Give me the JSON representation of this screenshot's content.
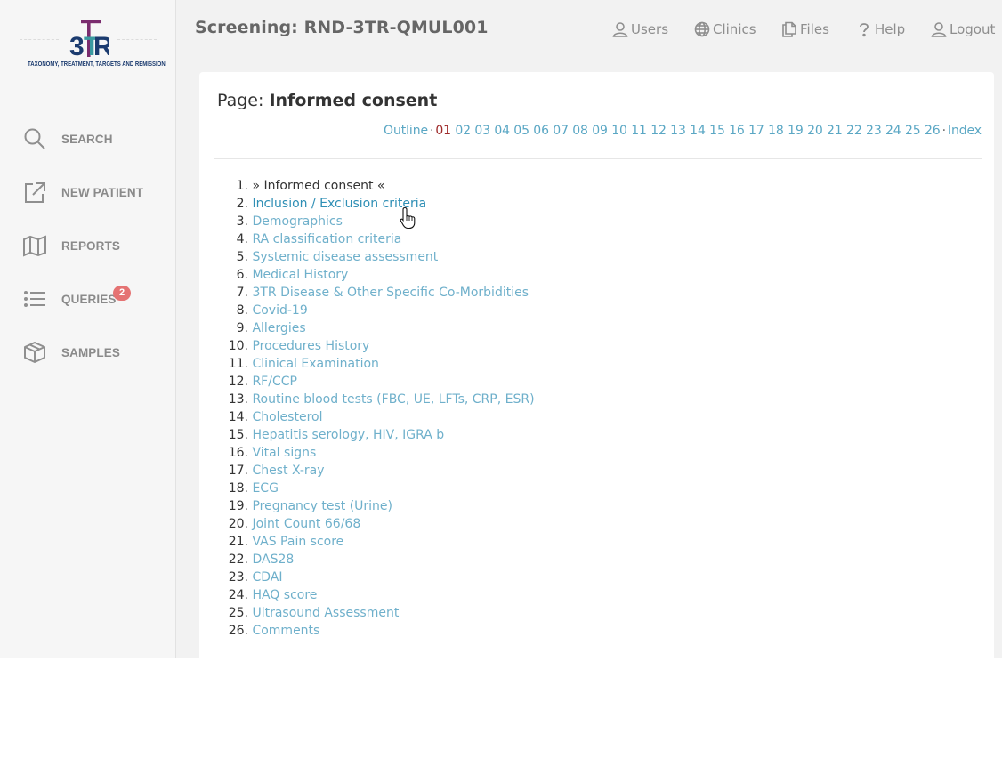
{
  "logo": {
    "text": "3TR",
    "tagline": "TAXONOMY, TREATMENT, TARGETS AND REMISSION.",
    "colors": {
      "teal": "#3a9aa0",
      "purple": "#7a2c6e",
      "navy": "#1b3b6f"
    }
  },
  "sidebar": {
    "items": [
      {
        "label": "SEARCH",
        "icon": "search-icon"
      },
      {
        "label": "NEW PATIENT",
        "icon": "external-link-icon"
      },
      {
        "label": "REPORTS",
        "icon": "map-icon"
      },
      {
        "label": "QUERIES",
        "icon": "list-icon",
        "badge": "2"
      },
      {
        "label": "SAMPLES",
        "icon": "box-icon"
      }
    ]
  },
  "header": {
    "title": "Screening: RND-3TR-QMUL001",
    "links": [
      {
        "label": "Users",
        "icon": "user-icon"
      },
      {
        "label": "Clinics",
        "icon": "globe-icon"
      },
      {
        "label": "Files",
        "icon": "files-icon"
      },
      {
        "label": "Help",
        "icon": "question-icon"
      },
      {
        "label": "Logout",
        "icon": "user-icon"
      }
    ]
  },
  "page": {
    "prefix": "Page:",
    "name": "Informed consent"
  },
  "pager": {
    "outline": "Outline",
    "separator": "·",
    "pages": [
      "01",
      "02",
      "03",
      "04",
      "05",
      "06",
      "07",
      "08",
      "09",
      "10",
      "11",
      "12",
      "13",
      "14",
      "15",
      "16",
      "17",
      "18",
      "19",
      "20",
      "21",
      "22",
      "23",
      "24",
      "25",
      "26"
    ],
    "current": "01",
    "index": "Index"
  },
  "sections": [
    {
      "num": "1.",
      "label": "» Informed consent «",
      "state": "current"
    },
    {
      "num": "2.",
      "label": "Inclusion / Exclusion criteria",
      "state": "hover"
    },
    {
      "num": "3.",
      "label": "Demographics"
    },
    {
      "num": "4.",
      "label": "RA classification criteria"
    },
    {
      "num": "5.",
      "label": "Systemic disease assessment"
    },
    {
      "num": "6.",
      "label": "Medical History"
    },
    {
      "num": "7.",
      "label": "3TR Disease & Other Specific Co-Morbidities"
    },
    {
      "num": "8.",
      "label": "Covid-19"
    },
    {
      "num": "9.",
      "label": "Allergies"
    },
    {
      "num": "10.",
      "label": "Procedures History"
    },
    {
      "num": "11.",
      "label": "Clinical Examination"
    },
    {
      "num": "12.",
      "label": "RF/CCP"
    },
    {
      "num": "13.",
      "label": "Routine blood tests (FBC, UE, LFTs, CRP, ESR)"
    },
    {
      "num": "14.",
      "label": "Cholesterol"
    },
    {
      "num": "15.",
      "label": "Hepatitis serology, HIV, IGRA b"
    },
    {
      "num": "16.",
      "label": "Vital signs"
    },
    {
      "num": "17.",
      "label": "Chest X-ray"
    },
    {
      "num": "18.",
      "label": "ECG"
    },
    {
      "num": "19.",
      "label": "Pregnancy test (Urine)"
    },
    {
      "num": "20.",
      "label": "Joint Count 66/68"
    },
    {
      "num": "21.",
      "label": "VAS Pain score"
    },
    {
      "num": "22.",
      "label": "DAS28"
    },
    {
      "num": "23.",
      "label": "CDAI"
    },
    {
      "num": "24.",
      "label": "HAQ score"
    },
    {
      "num": "25.",
      "label": "Ultrasound Assessment"
    },
    {
      "num": "26.",
      "label": "Comments"
    }
  ],
  "colors": {
    "link": "#6fb0cb",
    "link_hover": "#2f8fb5",
    "current_page": "#9e2a2a",
    "badge": "#e57373"
  }
}
